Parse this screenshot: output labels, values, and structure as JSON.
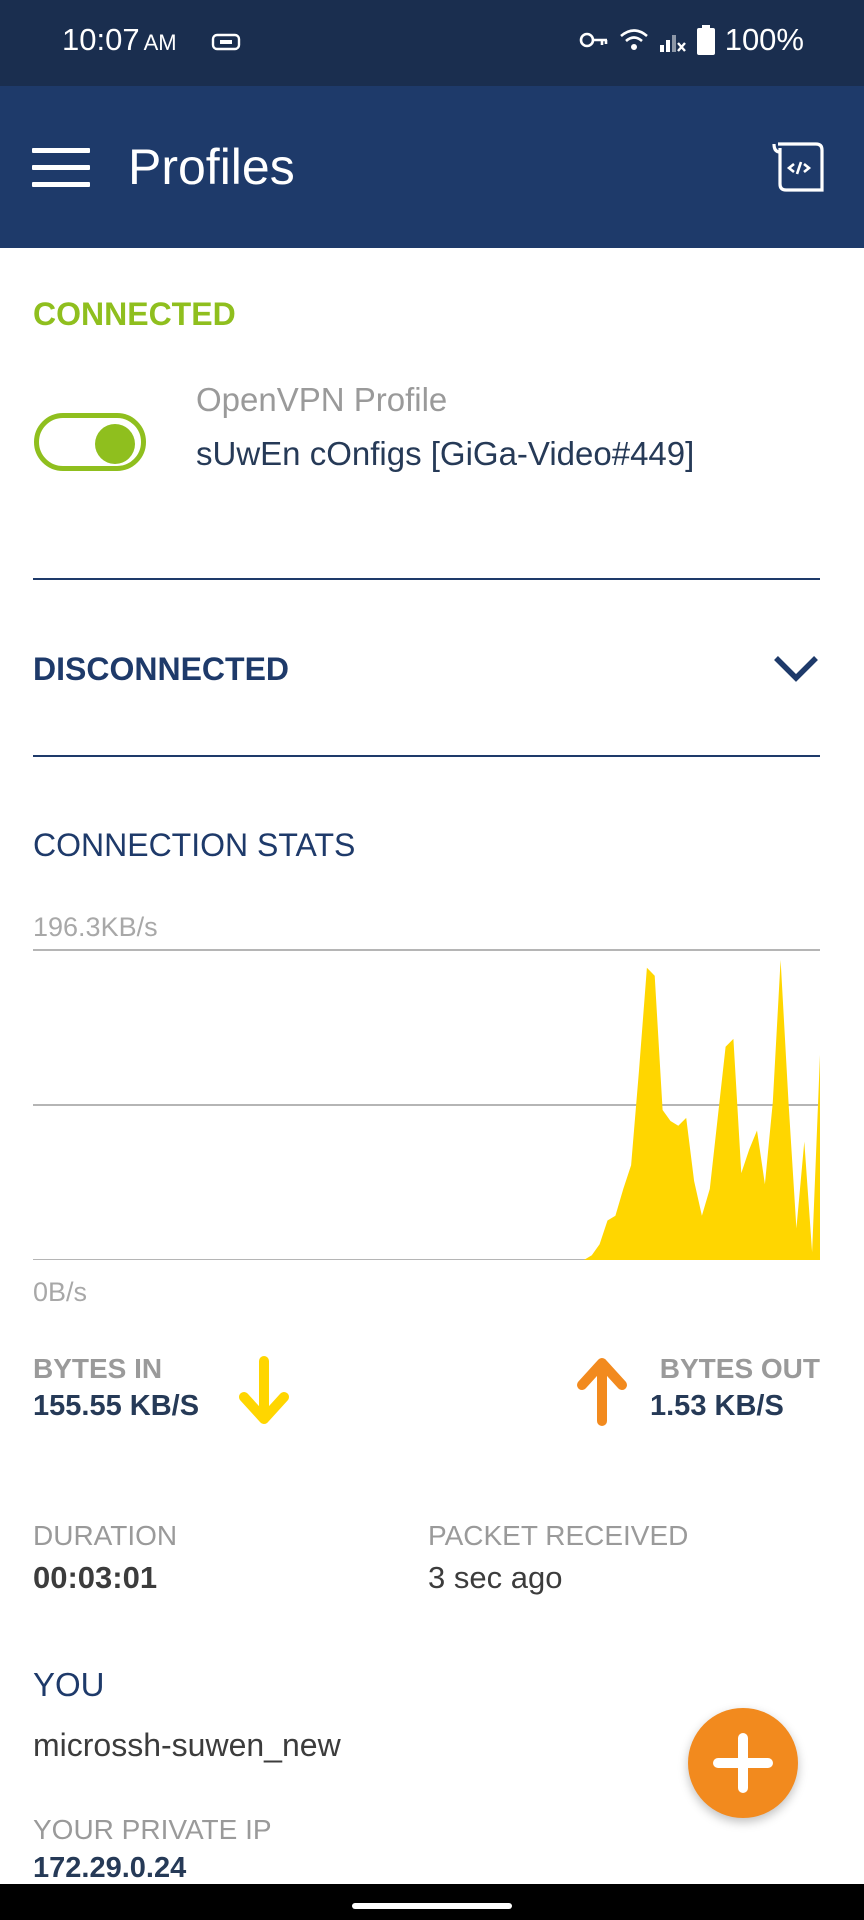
{
  "status_bar": {
    "time": "10:07",
    "ampm": "AM",
    "battery": "100%",
    "icons": [
      "vpn-key-icon",
      "wifi-icon",
      "signal-icon",
      "battery-icon"
    ]
  },
  "app_bar": {
    "title": "Profiles",
    "icons": [
      "menu-icon",
      "document-code-icon"
    ]
  },
  "connected": {
    "heading": "CONNECTED",
    "profile_type": "OpenVPN Profile",
    "profile_name": "sUwEn cOnfigs [GiGa-Video#449]",
    "toggle_on": true
  },
  "disconnected": {
    "heading": "DISCONNECTED"
  },
  "stats": {
    "heading": "CONNECTION STATS",
    "bytes_in_label": "BYTES IN",
    "bytes_in_value": "155.55 KB/S",
    "bytes_out_label": "BYTES OUT",
    "bytes_out_value": "1.53 KB/S",
    "duration_label": "DURATION",
    "duration_value": "00:03:01",
    "packet_label": "PACKET RECEIVED",
    "packet_value": "3 sec ago"
  },
  "chart_data": {
    "type": "area",
    "y_max_label": "196.3KB/s",
    "y_min_label": "0B/s",
    "ylim": [
      0,
      196.3
    ],
    "grid": true,
    "values": [
      0,
      0,
      0,
      0,
      0,
      0,
      0,
      0,
      0,
      0,
      0,
      0,
      0,
      0,
      0,
      0,
      0,
      0,
      0,
      0,
      0,
      0,
      0,
      0,
      0,
      0,
      0,
      0,
      0,
      0,
      0,
      0,
      0,
      0,
      0,
      0,
      0,
      0,
      0,
      0,
      0,
      0,
      0,
      0,
      0,
      0,
      0,
      0,
      0,
      0,
      0,
      0,
      0,
      0,
      0,
      0,
      0,
      0,
      0,
      0,
      0,
      0,
      0,
      0,
      0,
      0,
      0,
      0,
      0,
      0,
      0,
      3,
      10,
      25,
      28,
      45,
      60,
      120,
      185,
      180,
      95,
      88,
      85,
      90,
      50,
      28,
      45,
      90,
      135,
      140,
      55,
      70,
      82,
      48,
      100,
      190,
      100,
      20,
      75,
      5,
      130
    ],
    "color": "#ffd600"
  },
  "you": {
    "heading": "YOU",
    "name": "microssh-suwen_new",
    "ip_label": "YOUR PRIVATE IP",
    "ip_value": "172.29.0.24"
  },
  "colors": {
    "primary": "#1e3a6a",
    "connected": "#8fbf1e",
    "accent": "#f28a1e",
    "chart": "#ffd600"
  }
}
